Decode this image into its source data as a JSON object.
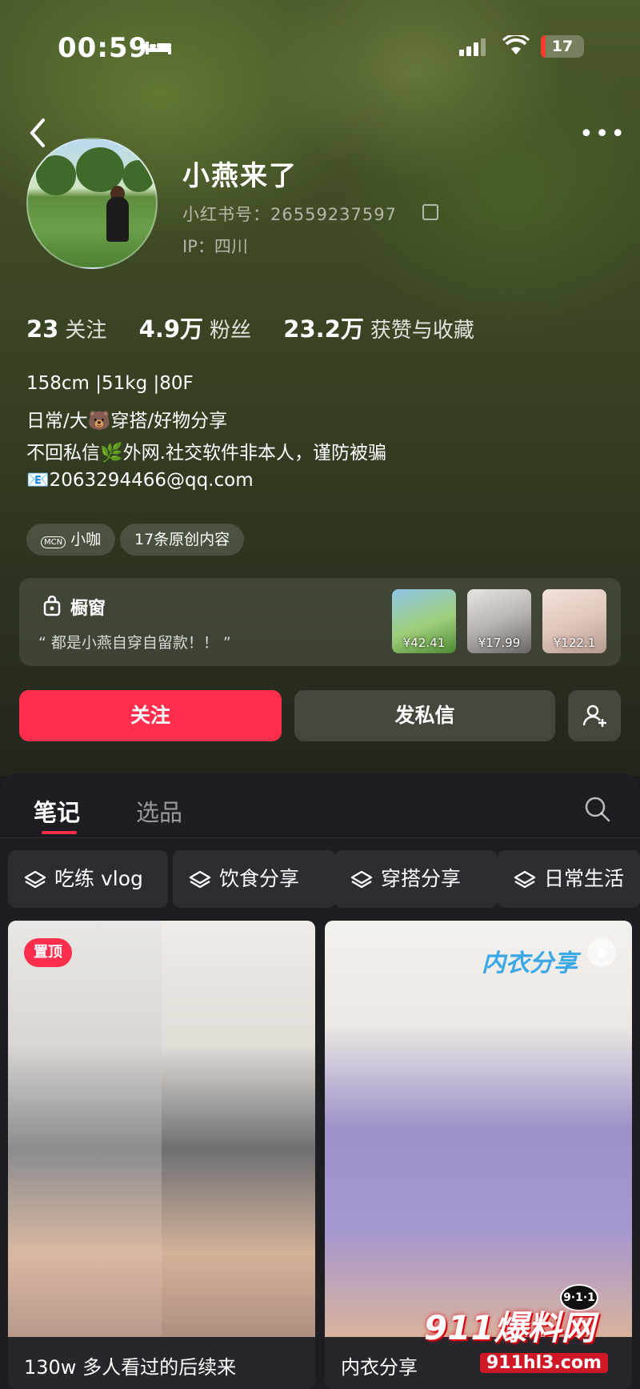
{
  "status": {
    "time": "00:59",
    "battery": "17"
  },
  "profile": {
    "name": "小燕来了",
    "red_id": "小红书号：26559237597",
    "ip": "IP：四川",
    "stats": [
      {
        "value": "23",
        "label": "关注"
      },
      {
        "value": "4.9万",
        "label": "粉丝"
      },
      {
        "value": "23.2万",
        "label": "获赞与收藏"
      }
    ],
    "bio": [
      "158cm |51kg |80F",
      "日常/大🐻穿搭/好物分享",
      "不回私信🌿外网.社交软件非本人，谨防被骗",
      "📧2063294466@qq.com"
    ],
    "tags": [
      "小咖",
      "17条原创内容"
    ],
    "tag_icon": "MCN"
  },
  "shop": {
    "title": "橱窗",
    "subtitle": "“ 都是小燕自穿自留款！！ ”",
    "items": [
      {
        "price": "¥42.41"
      },
      {
        "price": "¥17.99"
      },
      {
        "price": "¥122.1"
      }
    ]
  },
  "actions": {
    "follow": "关注",
    "message": "发私信"
  },
  "tabs": {
    "active": "笔记",
    "inactive": "选品"
  },
  "collections": [
    "吃练 vlog",
    "饮食分享",
    "穿搭分享",
    "日常生活"
  ],
  "notes": [
    {
      "badge": "置顶",
      "caption": "130w 多人看过的后续来"
    },
    {
      "overlay_title": "内衣分享",
      "caption": "内衣分享"
    }
  ],
  "watermark": {
    "brand": "911爆料网",
    "url": "911hl3.com",
    "logo": "9·1·1"
  },
  "colors": {
    "accent": "#ff2e4d",
    "panel": "#1e1e22"
  }
}
